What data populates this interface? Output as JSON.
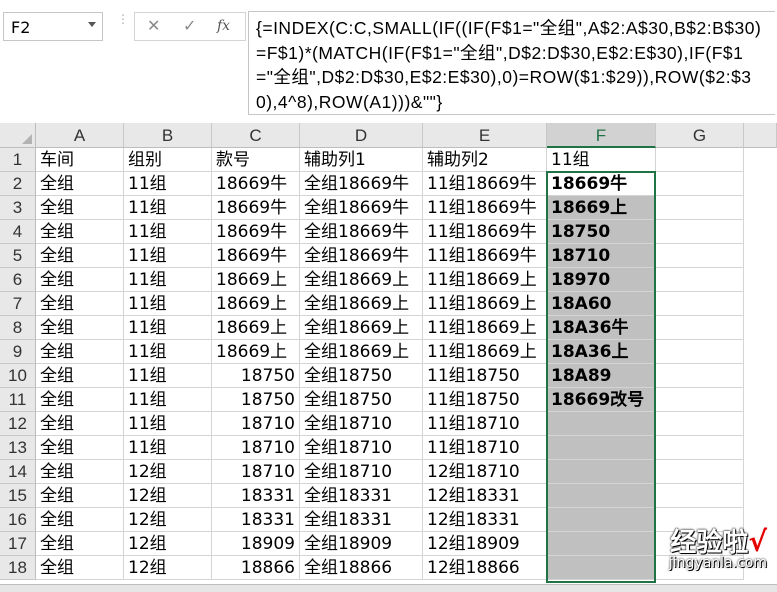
{
  "name_box": "F2",
  "toolbar_icons": {
    "cancel": "✕",
    "enter": "✓",
    "fx": "fx"
  },
  "formula": "{=INDEX(C:C,SMALL(IF((IF(F$1=\"全组\",A$2:A$30,B$2:B$30)=F$1)*(MATCH(IF(F$1=\"全组\",D$2:D$30,E$2:E$30),IF(F$1=\"全组\",D$2:D$30,E$2:E$30),0)=ROW($1:$29)),ROW($2:$30),4^8),ROW(A1)))&\"\"}",
  "columns": [
    "A",
    "B",
    "C",
    "D",
    "E",
    "F",
    "G"
  ],
  "selected_column": "F",
  "row_numbers": [
    "1",
    "2",
    "3",
    "4",
    "5",
    "6",
    "7",
    "8",
    "9",
    "10",
    "11",
    "12",
    "13",
    "14",
    "15",
    "16",
    "17",
    "18"
  ],
  "rows": [
    [
      "车间",
      "组别",
      "款号",
      "辅助列1",
      "辅助列2",
      "11组"
    ],
    [
      "全组",
      "11组",
      "18669牛",
      "全组18669牛",
      "11组18669牛",
      "18669牛"
    ],
    [
      "全组",
      "11组",
      "18669牛",
      "全组18669牛",
      "11组18669牛",
      "18669上"
    ],
    [
      "全组",
      "11组",
      "18669牛",
      "全组18669牛",
      "11组18669牛",
      "18750"
    ],
    [
      "全组",
      "11组",
      "18669牛",
      "全组18669牛",
      "11组18669牛",
      "18710"
    ],
    [
      "全组",
      "11组",
      "18669上",
      "全组18669上",
      "11组18669上",
      "18970"
    ],
    [
      "全组",
      "11组",
      "18669上",
      "全组18669上",
      "11组18669上",
      "18A60"
    ],
    [
      "全组",
      "11组",
      "18669上",
      "全组18669上",
      "11组18669上",
      "18A36牛"
    ],
    [
      "全组",
      "11组",
      "18669上",
      "全组18669上",
      "11组18669上",
      "18A36上"
    ],
    [
      "全组",
      "11组",
      "18750",
      "全组18750",
      "11组18750",
      "18A89"
    ],
    [
      "全组",
      "11组",
      "18750",
      "全组18750",
      "11组18750",
      "18669改号"
    ],
    [
      "全组",
      "11组",
      "18710",
      "全组18710",
      "11组18710",
      ""
    ],
    [
      "全组",
      "11组",
      "18710",
      "全组18710",
      "11组18710",
      ""
    ],
    [
      "全组",
      "12组",
      "18710",
      "全组18710",
      "12组18710",
      ""
    ],
    [
      "全组",
      "12组",
      "18331",
      "全组18331",
      "12组18331",
      ""
    ],
    [
      "全组",
      "12组",
      "18331",
      "全组18331",
      "12组18331",
      ""
    ],
    [
      "全组",
      "12组",
      "18909",
      "全组18909",
      "12组18909",
      ""
    ],
    [
      "全组",
      "12组",
      "18866",
      "全组18866",
      "12组18866",
      ""
    ]
  ],
  "watermark": {
    "text": "经验啦",
    "check": "√",
    "url": "jingyanla.com"
  },
  "colors": {
    "selection": "#217346",
    "fill_gray": "#c0c0c0",
    "header_bg": "#e8e8e8"
  }
}
